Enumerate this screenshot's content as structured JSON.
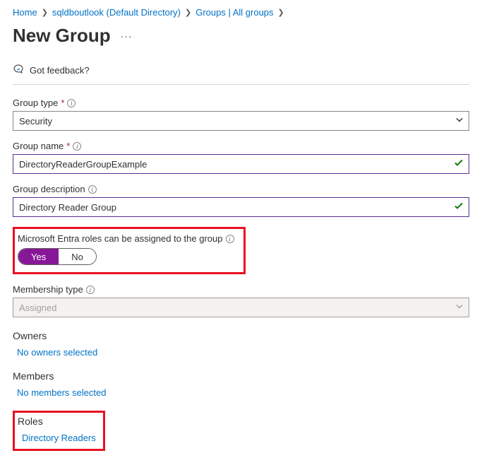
{
  "breadcrumb": {
    "home": "Home",
    "dir": "sqldboutlook (Default Directory)",
    "groups": "Groups | All groups"
  },
  "page_title": "New Group",
  "feedback_label": "Got feedback?",
  "fields": {
    "group_type": {
      "label": "Group type",
      "value": "Security"
    },
    "group_name": {
      "label": "Group name",
      "value": "DirectoryReaderGroupExample"
    },
    "group_description": {
      "label": "Group description",
      "value": "Directory Reader Group"
    },
    "roles_assignable": {
      "label": "Microsoft Entra roles can be assigned to the group",
      "yes": "Yes",
      "no": "No"
    },
    "membership_type": {
      "label": "Membership type",
      "value": "Assigned"
    }
  },
  "sections": {
    "owners": {
      "heading": "Owners",
      "value": "No owners selected"
    },
    "members": {
      "heading": "Members",
      "value": "No members selected"
    },
    "roles": {
      "heading": "Roles",
      "value": "Directory Readers"
    }
  }
}
